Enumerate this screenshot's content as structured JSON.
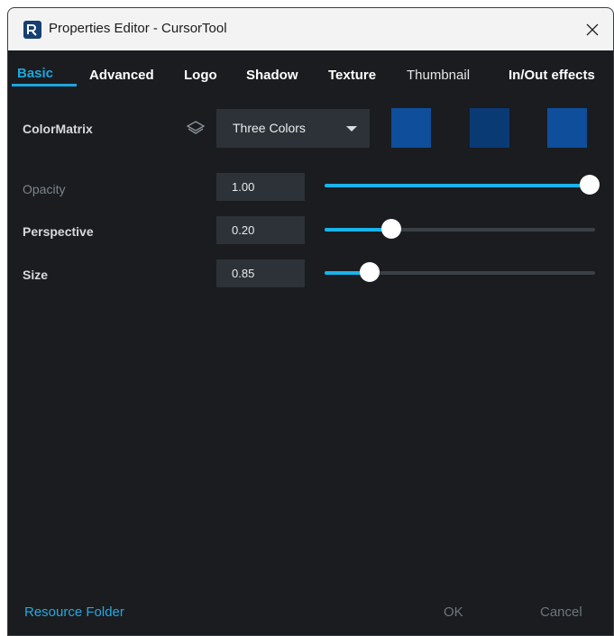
{
  "window": {
    "title": "Properties Editor - CursorTool"
  },
  "tabs": [
    {
      "label": "Basic"
    },
    {
      "label": "Advanced"
    },
    {
      "label": "Logo"
    },
    {
      "label": "Shadow"
    },
    {
      "label": "Texture"
    },
    {
      "label": "Thumbnail"
    },
    {
      "label": "In/Out effects"
    }
  ],
  "active_tab": "Basic",
  "color_matrix": {
    "label": "ColorMatrix",
    "dropdown_value": "Three Colors",
    "swatches": [
      "#0e4e9a",
      "#0a3a73",
      "#0e4e9a"
    ]
  },
  "properties": [
    {
      "label": "Opacity",
      "value": "1.00",
      "fraction": 1.0,
      "enabled": false
    },
    {
      "label": "Perspective",
      "value": "0.20",
      "fraction": 0.25,
      "enabled": true
    },
    {
      "label": "Size",
      "value": "0.85",
      "fraction": 0.17,
      "enabled": true
    }
  ],
  "footer": {
    "resource_folder": "Resource Folder",
    "ok": "OK",
    "cancel": "Cancel"
  },
  "colors": {
    "accent": "#1ba6e0",
    "background": "#1a1c1f",
    "field": "#2c3237"
  }
}
